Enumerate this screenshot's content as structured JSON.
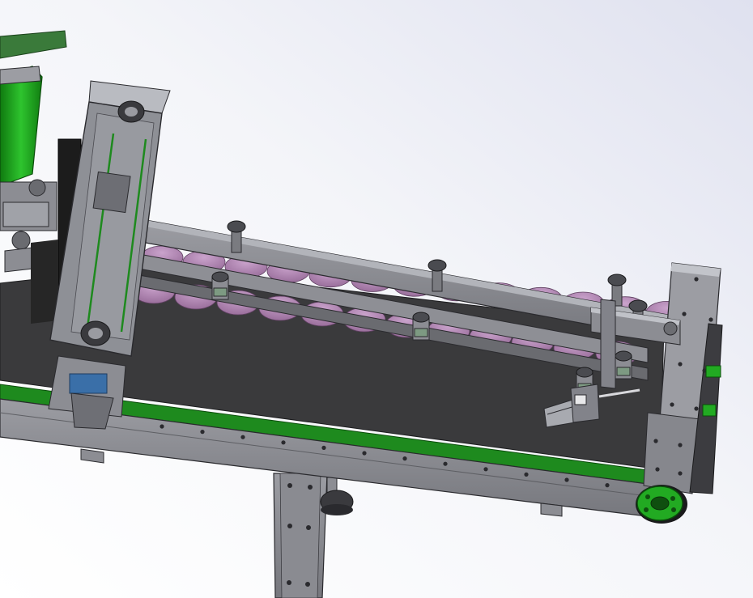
{
  "viewport": {
    "background_top_right": "#dfe1ef",
    "background_bottom_left": "#ffffff"
  },
  "colors": {
    "frame_grey": "#8c8d93",
    "frame_dark": "#5a5b60",
    "frame_light": "#aeb0b6",
    "belt_dark": "#3a3a3c",
    "belt_edge_green": "#1e8a1e",
    "bottle_purple": "#b489b4",
    "motor_green": "#22aa22",
    "coupling_blue": "#3a6fa8",
    "panel_black": "#1c1c1c",
    "outline": "#2a2a2e"
  },
  "parts": [
    {
      "name": "conveyor-frame",
      "icon": "frame-icon"
    },
    {
      "name": "conveyor-belt",
      "icon": "belt-icon"
    },
    {
      "name": "bottle-row",
      "icon": "bottle-icon"
    },
    {
      "name": "guide-rail-assembly",
      "icon": "rail-icon"
    },
    {
      "name": "vertical-gantry-module",
      "icon": "gantry-icon"
    },
    {
      "name": "gripper-cylinder",
      "icon": "cylinder-icon"
    },
    {
      "name": "end-plate",
      "icon": "plate-icon"
    },
    {
      "name": "drive-pulley",
      "icon": "pulley-icon"
    },
    {
      "name": "support-leg",
      "icon": "leg-icon"
    },
    {
      "name": "motor-unit",
      "icon": "motor-icon"
    }
  ]
}
